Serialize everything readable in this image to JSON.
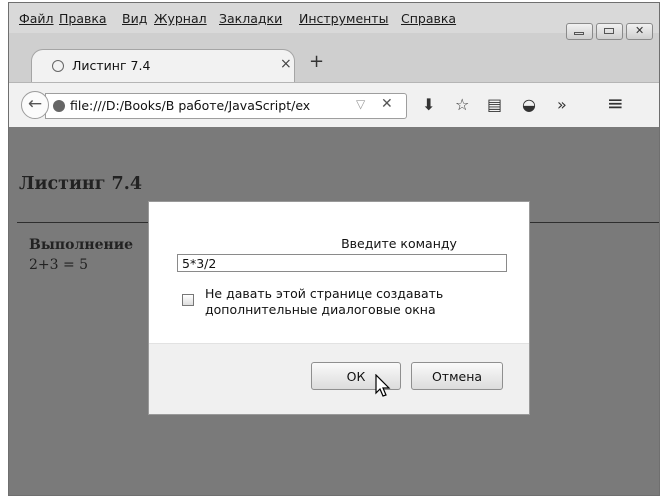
{
  "menu": [
    "Файл",
    "Правка",
    "Вид",
    "Журнал",
    "Закладки",
    "Инструменты",
    "Справка"
  ],
  "window_controls": {
    "minimize_icon": "minimize-icon",
    "maximize_icon": "maximize-icon",
    "close_symbol": "✕"
  },
  "tab": {
    "title": "Листинг 7.4",
    "close": "×"
  },
  "newtab": "+",
  "navbar": {
    "back": "←",
    "url": "file:///D:/Books/В работе/JavaScript/ex",
    "dropdown": "▽",
    "clear": "✕",
    "download": "⬇",
    "bookmark": "☆",
    "reader": "▤",
    "pocket": "◒",
    "overflow": "»",
    "menu": "≡"
  },
  "page": {
    "heading": "Листинг 7.4",
    "label": "Выполнение",
    "result": "2+3 = 5"
  },
  "dialog": {
    "prompt": "Введите команду",
    "input_value": "5*3/2",
    "checkbox_label_1": "Не давать этой странице создавать",
    "checkbox_label_2": "дополнительные диалоговые окна",
    "ok_label": "ОК",
    "cancel_label": "Отмена"
  }
}
